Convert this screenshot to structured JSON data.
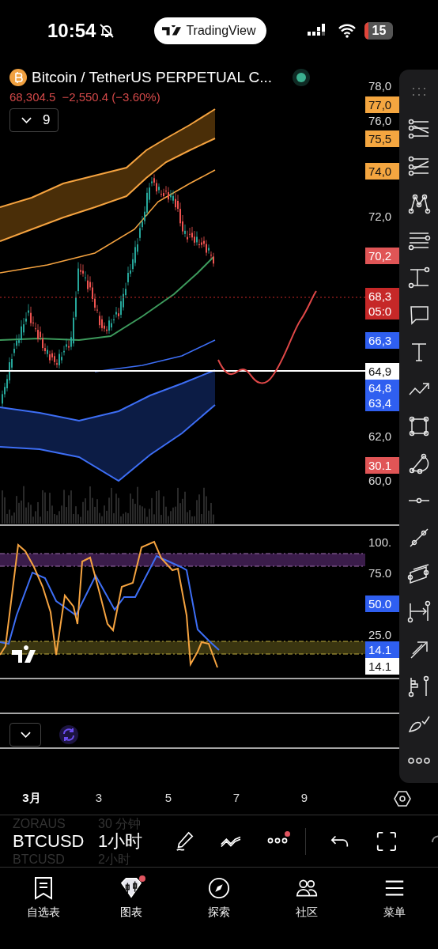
{
  "status_bar": {
    "time": "10:54",
    "app_pill": "TradingView",
    "battery": "15"
  },
  "symbol": {
    "name": "Bitcoin / TetherUS PERPETUAL C...",
    "price": "68,304.5",
    "change": "−2,550.4 (−3.60%)"
  },
  "indicators_toggle": {
    "count": "9"
  },
  "price_axis": [
    {
      "kind": "plain",
      "text": "78,0"
    },
    {
      "kind": "tag",
      "text": "77,0",
      "color": "#f4a640"
    },
    {
      "kind": "plain",
      "text": "76,0"
    },
    {
      "kind": "tag",
      "text": "75,5",
      "color": "#f4a640"
    },
    {
      "kind": "tag",
      "text": "74,0",
      "color": "#f4a640"
    },
    {
      "kind": "plain",
      "text": "72,0"
    },
    {
      "kind": "tag",
      "text": "70,2",
      "color": "#e05556"
    },
    {
      "kind": "tag",
      "text": "68,3",
      "text2": "05:0",
      "color": "#c62828"
    },
    {
      "kind": "tag",
      "text": "66,3",
      "color": "#2f5ff0"
    },
    {
      "kind": "tag",
      "text": "64,9",
      "color": "#ffffff"
    },
    {
      "kind": "tag",
      "text": "64,8",
      "text2": "63,4",
      "color": "#2f5ff0"
    },
    {
      "kind": "plain",
      "text": "62,0"
    },
    {
      "kind": "tag",
      "text": "30.1",
      "color": "#e05556"
    },
    {
      "kind": "plain",
      "text": "60,0"
    }
  ],
  "oscillator_axis": [
    {
      "kind": "plain",
      "text": "100."
    },
    {
      "kind": "plain",
      "text": "75.0"
    },
    {
      "kind": "tag",
      "text": "50.0",
      "color": "#2f5ff0"
    },
    {
      "kind": "plain",
      "text": "25.0"
    },
    {
      "kind": "tag",
      "text": "14.1",
      "color": "#2f5ff0"
    },
    {
      "kind": "tag",
      "text": "14.1",
      "color": "#ffffff"
    }
  ],
  "time_axis": [
    "3月",
    "3",
    "5",
    "7",
    "9"
  ],
  "picker": {
    "above": [
      "ZORAUS",
      "30 分钟"
    ],
    "current": [
      "BTCUSD",
      "1小时"
    ],
    "below": [
      "BTCUSD",
      "2小时"
    ]
  },
  "more_dot": true,
  "tabs": [
    {
      "label": "自选表",
      "selected": false,
      "dot": false
    },
    {
      "label": "图表",
      "selected": true,
      "dot": true
    },
    {
      "label": "探索",
      "selected": false,
      "dot": false
    },
    {
      "label": "社区",
      "selected": false,
      "dot": false
    },
    {
      "label": "菜单",
      "selected": false,
      "dot": false
    }
  ]
}
